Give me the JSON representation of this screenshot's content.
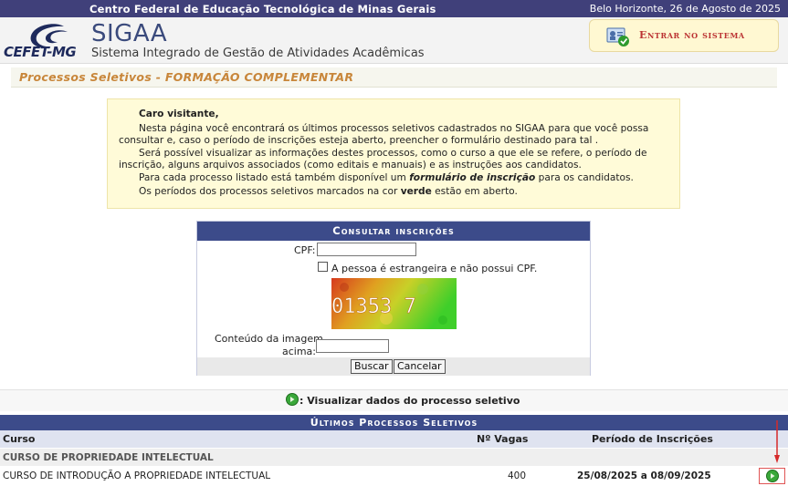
{
  "header": {
    "institution": "Centro Federal de Educação Tecnológica de Minas Gerais",
    "date_location": "Belo Horizonte, 26 de Agosto de 2025",
    "logo_text": "CEFET-MG",
    "system_name": "SIGAA",
    "system_subtitle": "Sistema Integrado de Gestão de Atividades Acadêmicas",
    "login_label": "Entrar no sistema"
  },
  "page": {
    "title": "Processos Seletivos - FORMAÇÃO COMPLEMENTAR"
  },
  "info": {
    "greeting": "Caro visitante,",
    "p1_line1": "Nesta página você encontrará os últimos processos seletivos cadastrados no SIGAA para que você possa",
    "p1_line2": "consultar e, caso o período de inscrições esteja aberto, preencher o formulário destinado para tal .",
    "p2_line1": "Será possível visualizar as informações destes processos, como o curso a que ele se refere, o período de",
    "p2_line2": "inscrição, alguns arquivos associados (como editais e manuais) e as instruções aos candidatos.",
    "p3_pre": "Para cada processo listado está também disponível um ",
    "p3_em": "formulário de inscrição",
    "p3_post": " para os candidatos.",
    "p4_pre": "Os períodos dos processos seletivos marcados na cor ",
    "p4_strong": "verde",
    "p4_post": " estão em aberto."
  },
  "consulta": {
    "caption": "Consultar inscrições",
    "cpf_label": "CPF:",
    "cpf_value": "",
    "foreign_label": "A pessoa é estrangeira e não possui CPF.",
    "captcha_text": "01353 7",
    "image_label_line1": "Conteúdo da imagem",
    "image_label_line2": "acima:",
    "image_value": "",
    "search_button": "Buscar",
    "cancel_button": "Cancelar"
  },
  "legend": {
    "text": ": Visualizar dados do processo seletivo"
  },
  "table": {
    "caption": "Últimos Processos Seletivos",
    "columns": [
      "Curso",
      "Nº Vagas",
      "Período de Inscrições"
    ],
    "group": "CURSO DE PROPRIEDADE INTELECTUAL",
    "rows": [
      {
        "curso": "CURSO DE INTRODUÇÃO A PROPRIEDADE INTELECTUAL",
        "vagas": "400",
        "periodo": "25/08/2025 a 08/09/2025"
      }
    ]
  },
  "colors": {
    "header_bar": "#40407a",
    "caption_bar": "#3c4b8a",
    "title_orange": "#c8863a",
    "open_green": "#1c8a1c",
    "info_bg": "#fffbd8"
  },
  "icons": {
    "logo": "cefet-logo-icon",
    "login": "login-user-icon",
    "view": "view-green-arrow-icon"
  }
}
